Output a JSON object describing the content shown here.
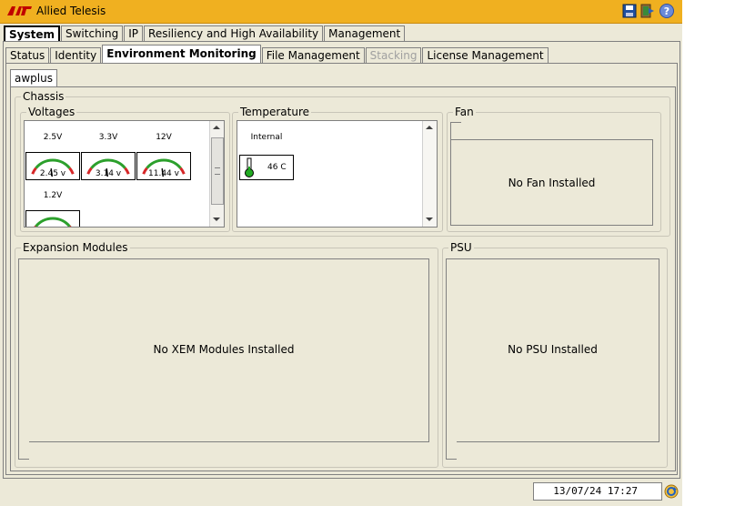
{
  "window": {
    "title": "Allied Telesis"
  },
  "main_tabs": [
    {
      "label": "System"
    },
    {
      "label": "Switching"
    },
    {
      "label": "IP"
    },
    {
      "label": "Resiliency and High Availability"
    },
    {
      "label": "Management"
    }
  ],
  "sub_tabs": [
    {
      "label": "Status"
    },
    {
      "label": "Identity"
    },
    {
      "label": "Environment Monitoring"
    },
    {
      "label": "File Management"
    },
    {
      "label": "Stacking"
    },
    {
      "label": "License Management"
    }
  ],
  "device_tab": {
    "label": "awplus"
  },
  "chassis": {
    "label": "Chassis",
    "voltages": {
      "label": "Voltages",
      "gauges": [
        {
          "label": "2.5V",
          "value": "2.45 v",
          "level": 0.45
        },
        {
          "label": "3.3V",
          "value": "3.14 v",
          "level": 0.45
        },
        {
          "label": "12V",
          "value": "11.44 v",
          "level": 0.45
        },
        {
          "label": "1.2V",
          "value": "",
          "level": 0.45
        }
      ]
    },
    "temperature": {
      "label": "Temperature",
      "sensor_label": "Internal",
      "value": "46 C"
    },
    "fan": {
      "label": "Fan",
      "message": "No Fan Installed"
    }
  },
  "expansion": {
    "label": "Expansion Modules",
    "message": "No XEM Modules Installed"
  },
  "psu": {
    "label": "PSU",
    "message": "No PSU Installed"
  },
  "statusbar": {
    "datetime": "13/07/24 17:27"
  },
  "colors": {
    "titlebar": "#f0b020",
    "gauge_green": "#2ca02c",
    "gauge_red": "#d62728"
  }
}
